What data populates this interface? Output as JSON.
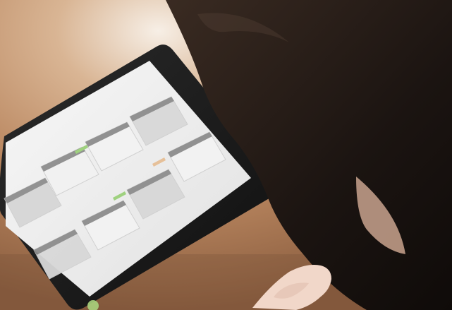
{
  "scene": {
    "subject": "tablet",
    "background_color": "#c99a6a",
    "tablet_bezel_color": "#1b1b1b",
    "screen_bg": "#e9e9e9",
    "hair_color": "#241a14",
    "skin_color": "#f0d6c6"
  },
  "tablet": {
    "card_count": 8
  }
}
